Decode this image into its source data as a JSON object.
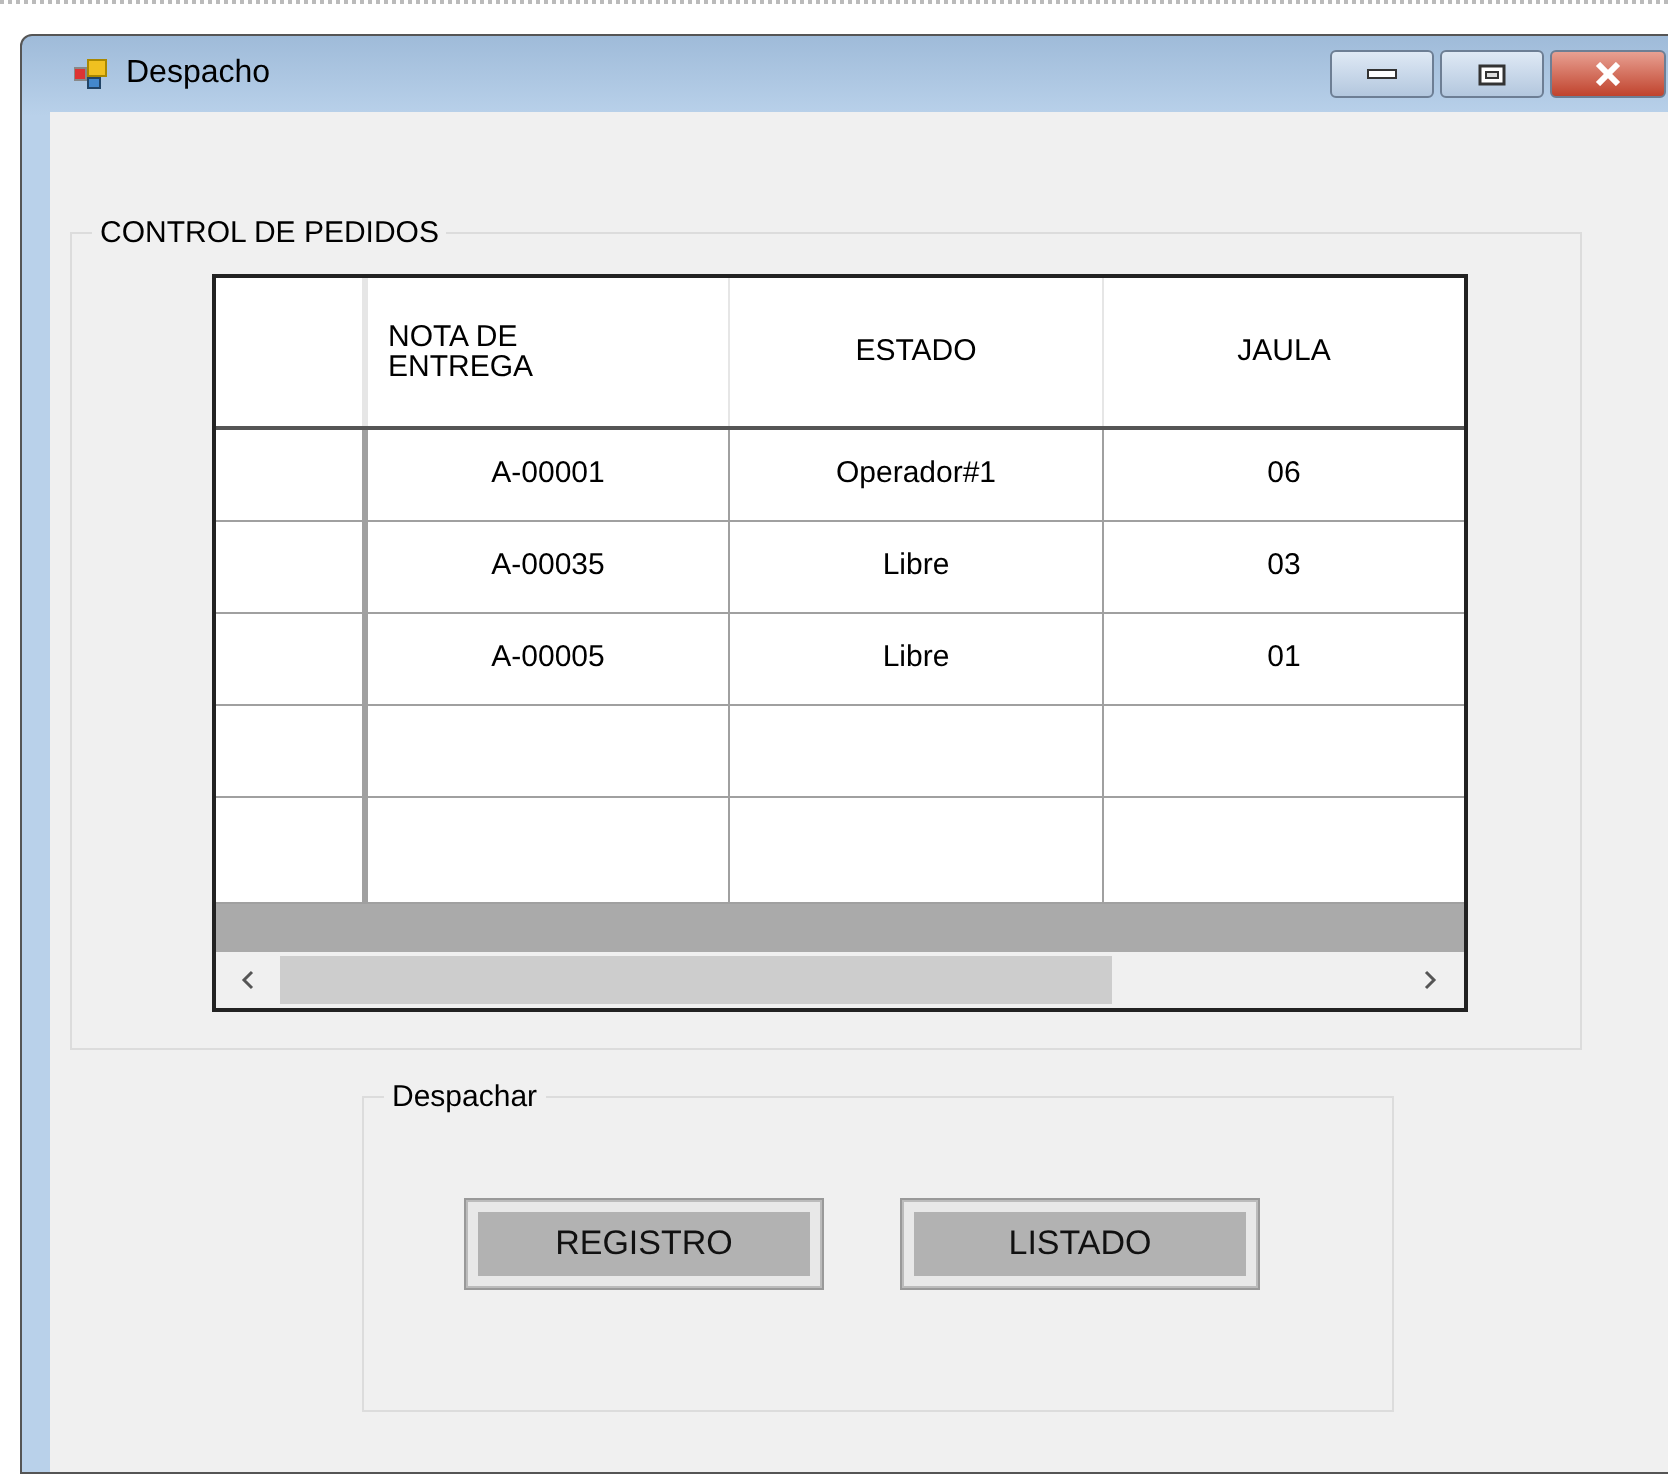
{
  "window": {
    "title": "Despacho"
  },
  "orders_group": {
    "title": "CONTROL DE PEDIDOS"
  },
  "table": {
    "columns": [
      "NOTA  DE ENTREGA",
      "ESTADO",
      "JAULA"
    ],
    "rows": [
      [
        "A-00001",
        "Operador#1",
        "06"
      ],
      [
        "A-00035",
        "Libre",
        "03"
      ],
      [
        "A-00005",
        "Libre",
        "01"
      ]
    ]
  },
  "dispatch_group": {
    "title": "Despachar",
    "buttons": [
      "REGISTRO",
      "LISTADO"
    ]
  }
}
